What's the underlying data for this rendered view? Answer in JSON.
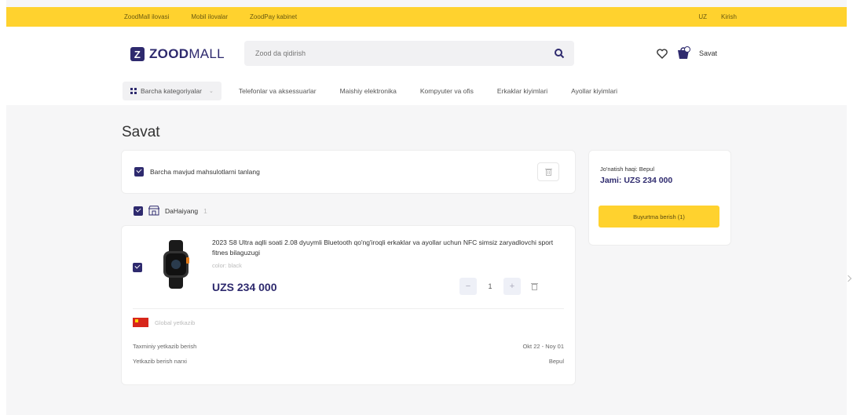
{
  "topbar": {
    "links": [
      "ZoodMall ilovasi",
      "Mobil ilovalar",
      "ZoodPay kabinet"
    ],
    "lang": "UZ",
    "account": "Kirish"
  },
  "header": {
    "logo_text_bold": "ZOOD",
    "logo_text_light": "MALL",
    "search_placeholder": "Zood da qidirish",
    "cart_label": "Savat"
  },
  "nav": {
    "all_categories": "Barcha kategoriyalar",
    "items": [
      "Telefonlar va aksessuarlar",
      "Maishiy elektronika",
      "Kompyuter va ofis",
      "Erkaklar kiyimlari",
      "Ayollar kiyimlari"
    ]
  },
  "page": {
    "title": "Savat"
  },
  "select_all": {
    "label": "Barcha mavjud mahsulotlarni tanlang"
  },
  "store": {
    "name": "DaHaiyang",
    "count": "1"
  },
  "product": {
    "name": "2023 S8 Ultra aqlli soati 2.08 dyuymli Bluetooth qo'ng'iroqli erkaklar va ayollar uchun NFC simsiz zaryadlovchi sport fitnes bilaguzugi",
    "color": "color: black",
    "price": "UZS 234 000",
    "quantity": "1",
    "ship_from": "Global yetkazib",
    "delivery_label": "Taxminiy yetkazib berish",
    "delivery_value": "Okt 22 - Noy 01",
    "cost_label": "Yetkazib berish narxi",
    "cost_value": "Bepul"
  },
  "summary": {
    "shipping": "Jo'natish haqi: Bepul",
    "total": "Jami: UZS 234 000",
    "order_button": "Buyurtma berish (1)"
  },
  "colors": {
    "accent_yellow": "#ffd22e",
    "brand_navy": "#2e2a6e"
  }
}
